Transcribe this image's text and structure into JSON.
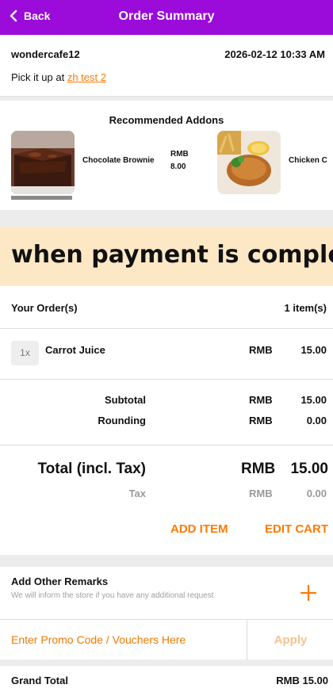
{
  "header": {
    "back_label": "Back",
    "title": "Order Summary"
  },
  "shop": {
    "name": "wondercafe12",
    "datetime": "2026-02-12 10:33 AM",
    "pickup_prefix": "Pick it up at",
    "pickup_location": "zh test 2"
  },
  "addons": {
    "title": "Recommended Addons",
    "items": [
      {
        "name": "Chocolate Brownie",
        "currency": "RMB",
        "price": "8.00"
      },
      {
        "name": "Chicken C"
      }
    ]
  },
  "banner": {
    "text": "when payment is complete."
  },
  "order": {
    "heading": "Your Order(s)",
    "count": "1 item(s)",
    "items": [
      {
        "qty": "1x",
        "name": "Carrot Juice",
        "currency": "RMB",
        "amount": "15.00"
      }
    ],
    "subtotal_label": "Subtotal",
    "subtotal_currency": "RMB",
    "subtotal": "15.00",
    "rounding_label": "Rounding",
    "rounding_currency": "RMB",
    "rounding": "0.00",
    "total_label": "Total (incl. Tax)",
    "total_currency": "RMB",
    "total": "15.00",
    "tax_label": "Tax",
    "tax_currency": "RMB",
    "tax": "0.00",
    "add_item_label": "ADD ITEM",
    "edit_cart_label": "EDIT CART"
  },
  "remarks": {
    "title": "Add Other Remarks",
    "hint": "We will inform the store if you have any additional request"
  },
  "promo": {
    "placeholder": "Enter Promo Code / Vouchers Here",
    "apply_label": "Apply"
  },
  "grand_total": {
    "label": "Grand Total",
    "value": "RMB 15.00"
  },
  "colors": {
    "header": "#9b0bd9",
    "accent": "#ff7a00",
    "banner": "#fde8c6"
  },
  "icons": {
    "back": "chevron-left-icon",
    "add_remark": "plus-icon"
  }
}
